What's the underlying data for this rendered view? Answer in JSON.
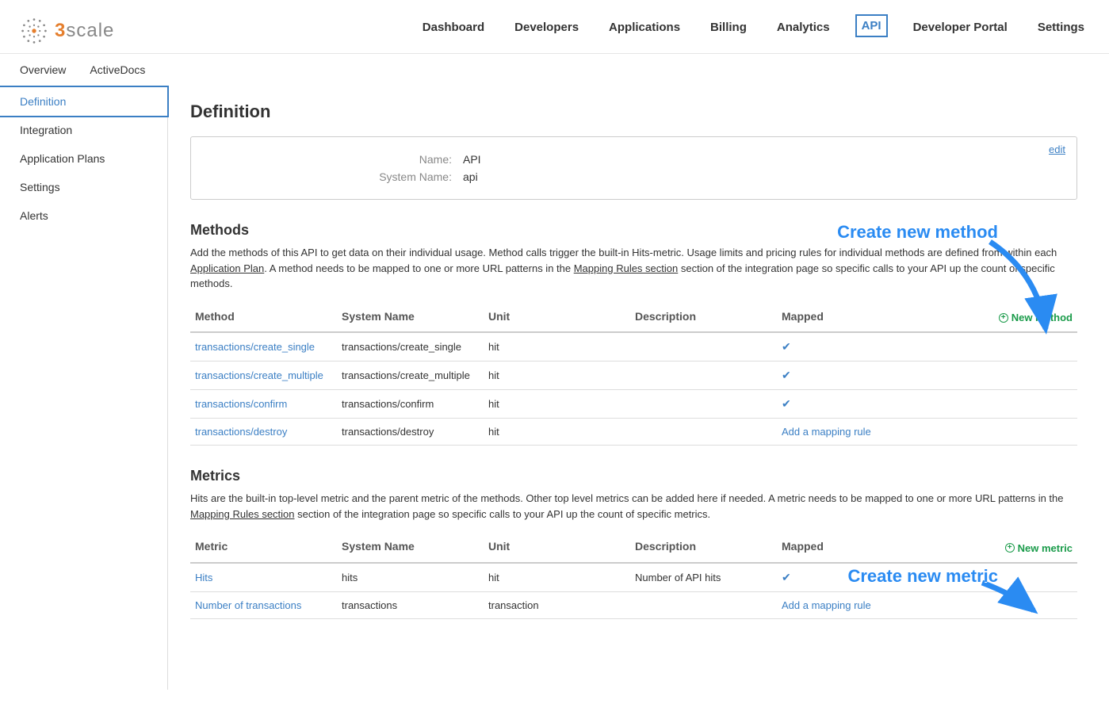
{
  "logo": {
    "three": "3",
    "scale": "scale"
  },
  "nav": {
    "items": [
      {
        "label": "Dashboard"
      },
      {
        "label": "Developers"
      },
      {
        "label": "Applications"
      },
      {
        "label": "Billing"
      },
      {
        "label": "Analytics"
      },
      {
        "label": "API",
        "active": true
      },
      {
        "label": "Developer Portal"
      },
      {
        "label": "Settings"
      }
    ]
  },
  "subnav": {
    "items": [
      {
        "label": "Overview"
      },
      {
        "label": "ActiveDocs"
      }
    ]
  },
  "sidebar": {
    "items": [
      {
        "label": "Definition",
        "active": true
      },
      {
        "label": "Integration"
      },
      {
        "label": "Application Plans"
      },
      {
        "label": "Settings"
      },
      {
        "label": "Alerts"
      }
    ]
  },
  "page_title": "Definition",
  "infobox": {
    "edit": "edit",
    "name_label": "Name:",
    "name_value": "API",
    "system_label": "System Name:",
    "system_value": "api"
  },
  "methods": {
    "heading": "Methods",
    "desc_1": "Add the methods of this API to get data on their individual usage. Method calls trigger the built-in Hits-metric. Usage limits and pricing rules for individual methods are defined from within each ",
    "link_1": "Application Plan",
    "desc_2": ". A method needs to be mapped to one or more URL patterns in the ",
    "link_2": "Mapping Rules section",
    "desc_3": " section of the integration page so specific calls to your API up the count of specific methods.",
    "cols": {
      "method": "Method",
      "system": "System Name",
      "unit": "Unit",
      "desc": "Description",
      "mapped": "Mapped"
    },
    "new_label": "New method",
    "rows": [
      {
        "name": "transactions/create_single",
        "system": "transactions/create_single",
        "unit": "hit",
        "desc": "",
        "mapped": "check"
      },
      {
        "name": "transactions/create_multiple",
        "system": "transactions/create_multiple",
        "unit": "hit",
        "desc": "",
        "mapped": "check"
      },
      {
        "name": "transactions/confirm",
        "system": "transactions/confirm",
        "unit": "hit",
        "desc": "",
        "mapped": "check"
      },
      {
        "name": "transactions/destroy",
        "system": "transactions/destroy",
        "unit": "hit",
        "desc": "",
        "mapped": "add"
      }
    ],
    "add_mapping_label": "Add a mapping rule"
  },
  "metrics": {
    "heading": "Metrics",
    "desc_1": "Hits are the built-in top-level metric and the parent metric of the methods. Other top level metrics can be added here if needed. A metric needs to be mapped to one or more URL patterns in the ",
    "link_1": "Mapping Rules section",
    "desc_2": " section of the integration page so specific calls to your API up the count of specific metrics.",
    "cols": {
      "metric": "Metric",
      "system": "System Name",
      "unit": "Unit",
      "desc": "Description",
      "mapped": "Mapped"
    },
    "new_label": "New metric",
    "rows": [
      {
        "name": "Hits",
        "system": "hits",
        "unit": "hit",
        "desc": "Number of API hits",
        "mapped": "check"
      },
      {
        "name": "Number of transactions",
        "system": "transactions",
        "unit": "transaction",
        "desc": "",
        "mapped": "add"
      }
    ],
    "add_mapping_label": "Add a mapping rule"
  },
  "annotations": {
    "create_method": "Create new method",
    "create_metric": "Create new metric"
  }
}
